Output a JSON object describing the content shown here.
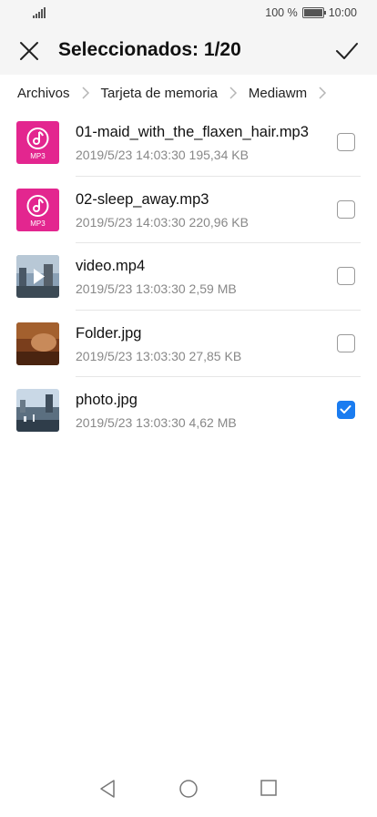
{
  "status": {
    "battery_text": "100 %",
    "time": "10:00"
  },
  "appbar": {
    "title": "Seleccionados: 1/20"
  },
  "breadcrumb": [
    "Archivos",
    "Tarjeta de memoria",
    "Mediawm"
  ],
  "files": [
    {
      "name": "01-maid_with_the_flaxen_hair.mp3",
      "meta": "2019/5/23 14:03:30 195,34 KB",
      "type": "mp3",
      "type_label": "MP3",
      "checked": false
    },
    {
      "name": "02-sleep_away.mp3",
      "meta": "2019/5/23 14:03:30 220,96 KB",
      "type": "mp3",
      "type_label": "MP3",
      "checked": false
    },
    {
      "name": "video.mp4",
      "meta": "2019/5/23 13:03:30 2,59 MB",
      "type": "video",
      "checked": false
    },
    {
      "name": "Folder.jpg",
      "meta": "2019/5/23 13:03:30 27,85 KB",
      "type": "image",
      "checked": false
    },
    {
      "name": "photo.jpg",
      "meta": "2019/5/23 13:03:30 4,62 MB",
      "type": "photo",
      "checked": true
    }
  ],
  "colors": {
    "accent": "#1a7cf0",
    "mp3": "#e3268f"
  }
}
